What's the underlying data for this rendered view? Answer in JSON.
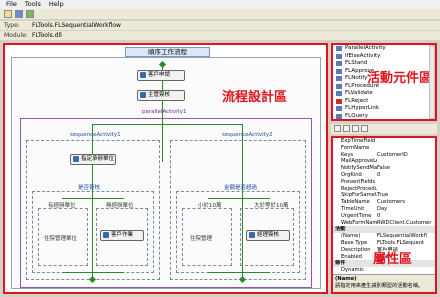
{
  "menu": {
    "items": [
      "File",
      "Tools",
      "Help"
    ]
  },
  "info": {
    "type_label": "Type:",
    "type_value": "FLTools.FLSequentialWorkflow",
    "module_label": "Module:",
    "module_value": "FLTools.dll"
  },
  "designer": {
    "workflow_title": "順序工作流程",
    "region_label": "流程設計區",
    "activities": {
      "customer_service": "客戶申請",
      "supervisor_sign": "主管簽核",
      "parallel": "parallelActivity1",
      "seq1": "sequenceActivity1",
      "seq2": "sequenceActivity2",
      "assign_clerk": "指定承辦單位",
      "if_sign": "是否簽核",
      "yes_branch": "有經辦單位",
      "no_branch": "無經辦單位",
      "handle_dept": "住院管理單位",
      "customer_proc": "客戶作業",
      "if_amount": "金額是否超過",
      "small_branch": "小於10萬",
      "large_branch": "大於等於10萬",
      "assistant": "住院管理",
      "manager": "經理簽核"
    }
  },
  "activity_panel": {
    "label": "活動元件區",
    "items": [
      "ParallelActivity",
      "IfElseActivity",
      "FLStand",
      "FLApprove",
      "FLNotify",
      "FLProcedure",
      "FLValidate",
      "FLReject",
      "FLHyperLink",
      "FLQuery"
    ]
  },
  "properties": {
    "label": "屬性區",
    "rows": [
      {
        "k": "ExpTimeField",
        "v": ""
      },
      {
        "k": "FormName",
        "v": ""
      },
      {
        "k": "Keys",
        "v": "CustomerID"
      },
      {
        "k": "MailApproveLevel",
        "v": ""
      },
      {
        "k": "NotifySendMail",
        "v": "False"
      },
      {
        "k": "OrgKind",
        "v": "0"
      },
      {
        "k": "PresentFields",
        "v": ""
      },
      {
        "k": "RejectProcedure",
        "v": ""
      },
      {
        "k": "SkipForSameUser",
        "v": "True"
      },
      {
        "k": "TableName",
        "v": "Customers"
      },
      {
        "k": "TimeUnit",
        "v": "Day"
      },
      {
        "k": "UrgentTime",
        "v": "0"
      },
      {
        "k": "WebFormName",
        "v": "RWDClient.Customer"
      }
    ],
    "cat_activity": "活動",
    "activity_rows": [
      {
        "k": "(Name)",
        "v": "FLSequentialWorkfl"
      },
      {
        "k": "Base Type",
        "v": "FLTools.FLSequent"
      },
      {
        "k": "Description",
        "v": "客戶申請"
      },
      {
        "k": "Enabled",
        "v": "True"
      }
    ],
    "cat_cond": "條件",
    "cond_rows": [
      {
        "k": "Dynamic",
        "v": ""
      }
    ],
    "desc_title": "(Name)",
    "desc_text": "請指定用來產生識別類型的活動名稱。"
  }
}
